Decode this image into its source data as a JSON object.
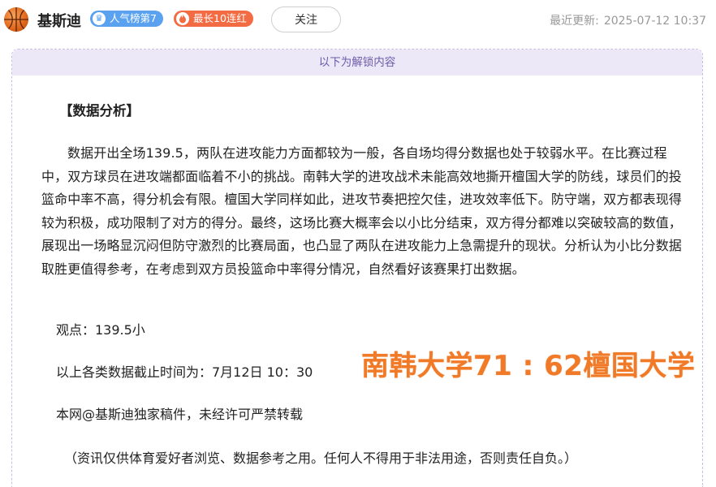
{
  "header": {
    "author_name": "基斯迪",
    "badges": {
      "popularity": "人气榜第7",
      "streak": "最长10连红"
    },
    "follow_label": "关注",
    "updated_label": "最近更新:",
    "updated_time": "2025-07-12 10:37"
  },
  "content": {
    "unlock_notice": "以下为解锁内容",
    "section_title": "【数据分析】",
    "analysis": "数据开出全场139.5，两队在进攻能力方面都较为一般，各自场均得分数据也处于较弱水平。在比赛过程中，双方球员在进攻端都面临着不小的挑战。南韩大学的进攻战术未能高效地撕开檀国大学的防线，球员们的投篮命中率不高，得分机会有限。檀国大学同样如此，进攻节奏把控欠佳，进攻效率低下。防守端，双方都表现得较为积极，成功限制了对方的得分。最终，这场比赛大概率会以小比分结束，双方得分都难以突破较高的数值，展现出一场略显沉闷但防守激烈的比赛局面，也凸显了两队在进攻能力上急需提升的现状。分析认为小比分数据取胜更值得参考，在考虑到双方员投篮命中率得分情况，自然看好该赛果打出数据。",
    "view": "观点：139.5小",
    "cutoff": "以上各类数据截止时间为：7月12日 10：30",
    "copyright": "本网@基斯迪独家稿件，未经许可严禁转载",
    "disclaimer": "（资讯仅供体育爱好者浏览、数据参考之用。任何人不得用于非法用途，否则责任自负。）",
    "score_overlay": "南韩大学71 : 62檀国大学"
  },
  "colors": {
    "accent_purple": "#6b5ca8",
    "badge_blue": "#5aa2ef",
    "badge_orange": "#f26b43",
    "score_orange": "#f07a28"
  },
  "icons": {
    "avatar": "basketball-icon",
    "popularity_badge": "crown-icon",
    "streak_badge": "flame-icon"
  }
}
